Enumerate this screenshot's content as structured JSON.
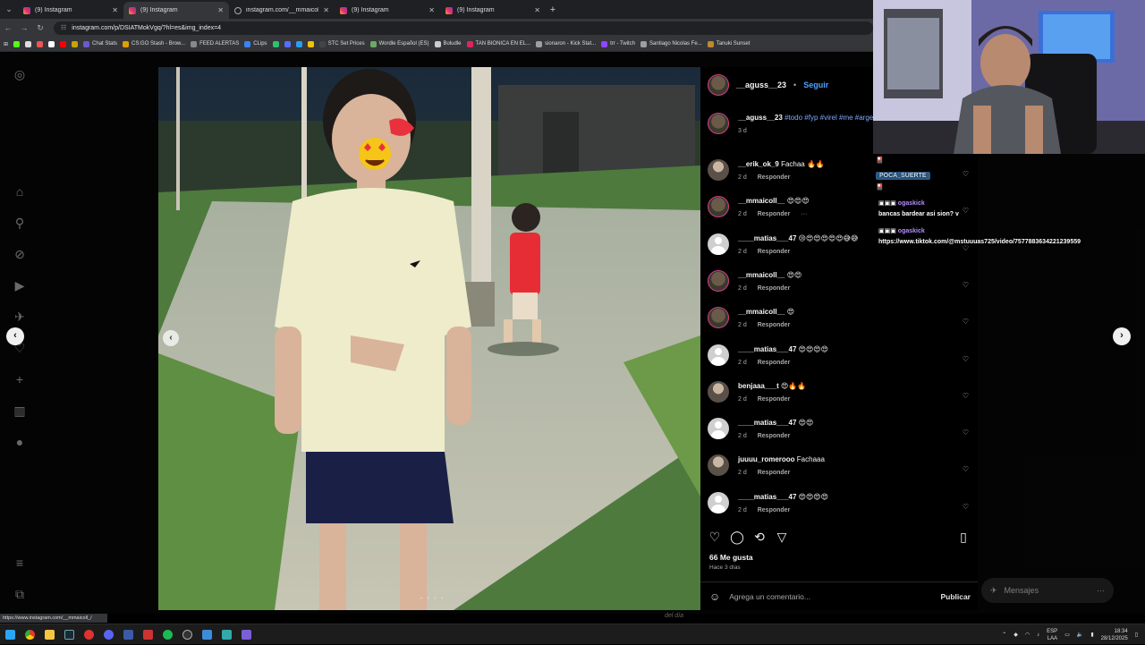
{
  "tabs": [
    {
      "title": "(9) Instagram",
      "active": false,
      "icon": "instagram-icon"
    },
    {
      "title": "(9) Instagram",
      "active": true,
      "icon": "instagram-icon"
    },
    {
      "title": "instagram.com/__mmaicoll_/",
      "active": false,
      "icon": "link-icon"
    },
    {
      "title": "(9) Instagram",
      "active": false,
      "icon": "instagram-icon"
    },
    {
      "title": "(9) Instagram",
      "active": false,
      "icon": "instagram-icon"
    }
  ],
  "address": {
    "url": "instagram.com/p/DSIATMokVgq/?hl=es&img_index=4"
  },
  "bookmarks": [
    {
      "label": "Chat Stats",
      "color": "#6a5acd"
    },
    {
      "label": "CS:GO Stash - Brow...",
      "color": "#e0a000"
    },
    {
      "label": "FEED ALERTAS",
      "color": "#888888"
    },
    {
      "label": "CLips",
      "color": "#3b82f6"
    },
    {
      "label": "STC Set Prices",
      "color": "#444444"
    },
    {
      "label": "Wordle Español (ES)",
      "color": "#6aaa64"
    },
    {
      "label": "Boludle",
      "color": "#cccccc"
    },
    {
      "label": "TAN BIONICA EN EL...",
      "color": "#e0245e"
    },
    {
      "label": "sionaron - Kick Stat...",
      "color": "#9aa0a6"
    },
    {
      "label": "trr - Twitch",
      "color": "#9146ff"
    },
    {
      "label": "Santiago Nicolas Fe...",
      "color": "#9aa0a6"
    },
    {
      "label": "Tanuki Sunset",
      "color": "#c08a30"
    }
  ],
  "post": {
    "author": "__aguss__23",
    "follow_label": "Seguir",
    "caption_author": "__aguss__23",
    "caption": "#todo #fyp #virel #me #argentinaaa",
    "caption_age": "3 d",
    "likes": "66 Me gusta",
    "posted": "Hace 3 días",
    "comment_placeholder": "Agrega un comentario...",
    "publish_label": "Publicar"
  },
  "comments": [
    {
      "user": "__erik_ok_9",
      "text": "Fachaa 🔥🔥",
      "age": "2 d",
      "reply": "Responder",
      "avatar": "photo"
    },
    {
      "user": "__mmaicoll__",
      "text": "😍😍😍",
      "age": "2 d",
      "reply": "Responder",
      "more": "···",
      "avatar": "ring"
    },
    {
      "user": "____matias___47",
      "text": "😢😍😍😍😍😍😅😅",
      "age": "2 d",
      "reply": "Responder",
      "avatar": "default"
    },
    {
      "user": "__mmaicoll__",
      "text": "😍😍",
      "age": "2 d",
      "reply": "Responder",
      "avatar": "ring"
    },
    {
      "user": "__mmaicoll__",
      "text": "😍",
      "age": "2 d",
      "reply": "Responder",
      "avatar": "ring"
    },
    {
      "user": "____matias___47",
      "text": "😍😍😍😍",
      "age": "2 d",
      "reply": "Responder",
      "avatar": "default"
    },
    {
      "user": "benjaaa___t",
      "text": "😍🔥🔥",
      "age": "2 d",
      "reply": "Responder",
      "avatar": "photo"
    },
    {
      "user": "____matias___47",
      "text": "😍😍",
      "age": "2 d",
      "reply": "Responder",
      "avatar": "default"
    },
    {
      "user": "juuuu_romerooo",
      "text": "Fachaaa",
      "age": "2 d",
      "reply": "Responder",
      "avatar": "photo"
    },
    {
      "user": "____matias___47",
      "text": "😍😍😍😍",
      "age": "2 d",
      "reply": "Responder",
      "avatar": "default"
    }
  ],
  "messages": {
    "label": "Mensajes"
  },
  "chat": {
    "badge": "POCA_SUERTE",
    "lines": [
      {
        "user": "ogaskick",
        "text": "bancas bardear asi sion? v"
      },
      {
        "user": "ogaskick",
        "text": "https://www.tiktok.com/@mstuuuas725/video/7577883634221239559"
      }
    ]
  },
  "status_url": "https://www.instagram.com/__mmaicoll_/",
  "photo_watermark": "del día",
  "tray": {
    "lang": "ESP",
    "layout": "LAA",
    "time": "18:34",
    "date": "28/12/2025"
  }
}
